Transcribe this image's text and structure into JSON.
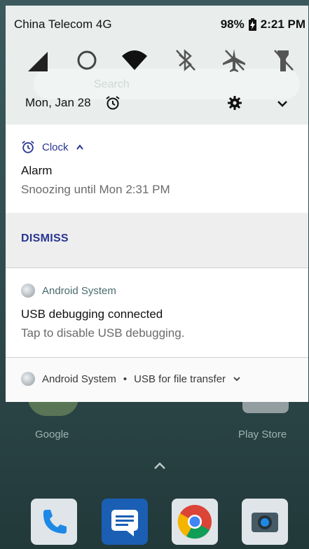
{
  "status_bar": {
    "carrier": "China Telecom 4G",
    "battery": "98%",
    "time": "2:21 PM"
  },
  "quick_settings": {
    "tiles": [
      "signal-icon",
      "sync-icon",
      "wifi-icon",
      "bluetooth-off-icon",
      "airplane-mode-icon",
      "flashlight-off-icon"
    ],
    "search_hint": "Search",
    "date": "Mon, Jan 28"
  },
  "notifications": {
    "clock": {
      "app": "Clock",
      "title": "Alarm",
      "text": "Snoozing until Mon 2:31 PM",
      "action": "DISMISS"
    },
    "usb": {
      "app": "Android System",
      "title": "USB debugging connected",
      "text": "Tap to disable USB debugging."
    },
    "mtp": {
      "app": "Android System",
      "separator": "•",
      "summary": "USB for file transfer"
    }
  },
  "home": {
    "apps": [
      "Google",
      "Play Store"
    ],
    "dock": [
      "phone-icon",
      "messages-icon",
      "chrome-icon",
      "camera-icon"
    ]
  },
  "colors": {
    "accent": "#283593",
    "panel": "#e9eeec"
  }
}
